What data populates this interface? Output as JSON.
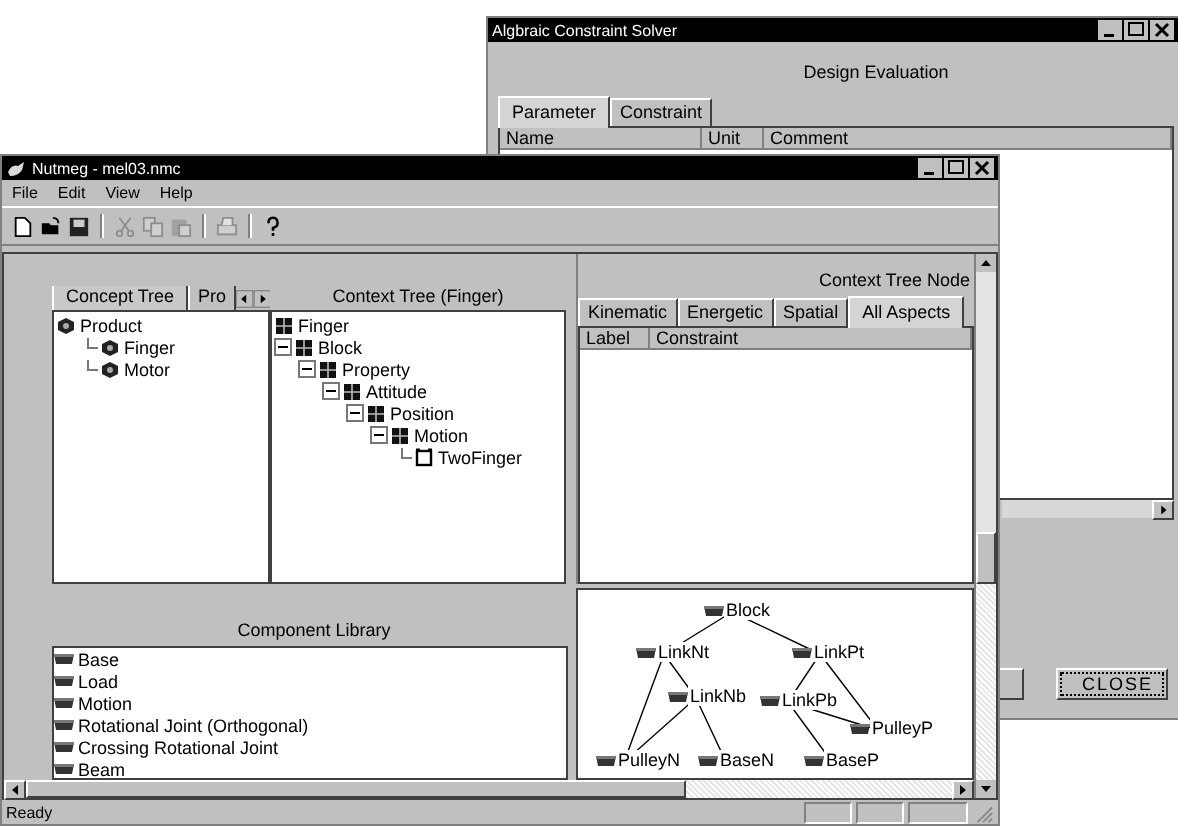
{
  "solver_window": {
    "title": "Algbraic Constraint Solver",
    "heading": "Design Evaluation",
    "tabs": [
      {
        "label": "Parameter",
        "selected": true
      },
      {
        "label": "Constraint",
        "selected": false
      }
    ],
    "columns": [
      "Name",
      "Unit",
      "Comment"
    ],
    "buttons": [
      "CLOSE"
    ]
  },
  "main_window": {
    "title": "Nutmeg - mel03.nmc",
    "menu": [
      "File",
      "Edit",
      "View",
      "Help"
    ],
    "toolbar": [
      {
        "kind": "new",
        "disabled": false
      },
      {
        "kind": "open",
        "disabled": false
      },
      {
        "kind": "save",
        "disabled": false
      },
      {
        "kind": "separator"
      },
      {
        "kind": "cut",
        "disabled": true
      },
      {
        "kind": "copy",
        "disabled": true
      },
      {
        "kind": "paste",
        "disabled": true
      },
      {
        "kind": "separator"
      },
      {
        "kind": "print",
        "disabled": true
      },
      {
        "kind": "separator"
      },
      {
        "kind": "help",
        "disabled": false
      }
    ],
    "concept_tabs": [
      {
        "label": "Concept Tree",
        "selected": true
      },
      {
        "label": "Pro",
        "selected": false
      }
    ],
    "concept_tree": {
      "nodes": [
        {
          "label": "Product",
          "kind": "concept",
          "children": [
            {
              "label": "Finger",
              "kind": "concept"
            },
            {
              "label": "Motor",
              "kind": "concept"
            }
          ]
        }
      ]
    },
    "context_tree": {
      "title": "Context Tree (Finger)",
      "nodes": [
        {
          "label": "Finger",
          "kind": "context"
        },
        {
          "label": "Block",
          "kind": "context",
          "expanded": true,
          "children": [
            {
              "label": "Property",
              "kind": "context",
              "expanded": true,
              "children": [
                {
                  "label": "Attitude",
                  "kind": "context",
                  "expanded": true,
                  "children": [
                    {
                      "label": "Position",
                      "kind": "context",
                      "expanded": true,
                      "children": [
                        {
                          "label": "Motion",
                          "kind": "context",
                          "expanded": true,
                          "children": [
                            {
                              "label": "TwoFinger",
                              "kind": "frame"
                            }
                          ]
                        }
                      ]
                    }
                  ]
                }
              ]
            }
          ]
        }
      ]
    },
    "node_panel": {
      "title": "Context Tree Node",
      "tabs": [
        {
          "label": "Kinematic",
          "selected": false
        },
        {
          "label": "Energetic",
          "selected": false
        },
        {
          "label": "Spatial",
          "selected": false
        },
        {
          "label": "All Aspects",
          "selected": true
        }
      ],
      "columns": [
        "Label",
        "Constraint"
      ]
    },
    "component_library": {
      "title": "Component Library",
      "items": [
        "Base",
        "Load",
        "Motion",
        "Rotational Joint (Orthogonal)",
        "Crossing Rotational Joint",
        "Beam"
      ]
    },
    "graph": {
      "nodes": [
        "Block",
        "LinkNt",
        "LinkPt",
        "LinkNb",
        "LinkPb",
        "PulleyP",
        "PulleyN",
        "BaseN",
        "BaseP"
      ]
    },
    "status": "Ready"
  }
}
